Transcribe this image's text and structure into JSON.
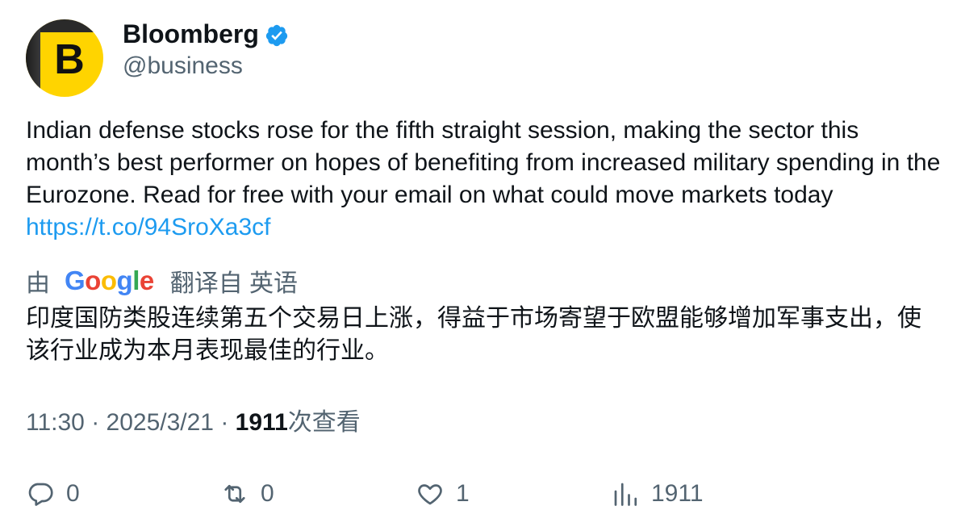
{
  "author": {
    "display_name": "Bloomberg",
    "handle": "@business",
    "verified": true,
    "avatar_letter": "B"
  },
  "tweet": {
    "text": "Indian defense stocks rose for the fifth straight session, making the sector this month’s best performer on hopes of benefiting from increased military spending in the Eurozone. Read for free with your email on what could move markets today",
    "link": "https://t.co/94SroXa3cf"
  },
  "translation": {
    "by_label": "由",
    "provider": "Google",
    "from_label": "翻译自 英语",
    "text": "印度国防类股连续第五个交易日上涨，得益于市场寄望于欧盟能够增加军事支出，使该行业成为本月表现最佳的行业。"
  },
  "meta": {
    "time": "11:30",
    "date": "2025/3/21",
    "views_count": "1911",
    "views_label": "次查看"
  },
  "actions": {
    "replies": "0",
    "retweets": "0",
    "likes": "1",
    "views": "1911"
  },
  "colors": {
    "text": "#0f1419",
    "secondary": "#536471",
    "link": "#1d9bf0",
    "verified": "#1d9bf0",
    "avatar_bg": "#ffd400"
  }
}
